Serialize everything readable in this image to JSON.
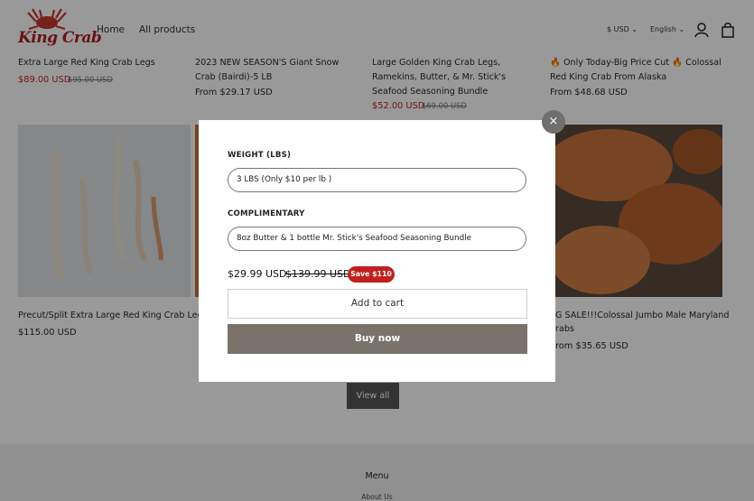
{
  "header": {
    "logo_text": "King Crab",
    "nav": [
      "Home",
      "All products"
    ],
    "currency": "$ USD",
    "language": "English"
  },
  "products_row1": [
    {
      "title": "Extra Large Red King Crab Legs",
      "price": "$89.00 USD",
      "compare": "$95.00 USD"
    },
    {
      "title": "2023 NEW SEASON'S Giant Snow Crab (Bairdi)-5 LB",
      "price": "From $29.17 USD"
    },
    {
      "title": "Large Golden King Crab Legs, Ramekins, Butter, & Mr. Stick's Seafood Seasoning Bundle",
      "price": "$52.00 USD",
      "compare": "$69.00 USD"
    },
    {
      "title": "🔥 Only Today-Big Price Cut 🔥 Colossal Red King Crab From Alaska",
      "price": "From $48.68 USD"
    }
  ],
  "products_row2": [
    {
      "title": "Precut/Split Extra Large Red King Crab Legs",
      "price": "$115.00 USD"
    },
    {
      "title": "G SALE!!!Colossal Jumbo Male Maryland",
      "title2": "rabs",
      "price": "rom $35.65 USD"
    }
  ],
  "view_all": "View all",
  "footer": {
    "menu_title": "Menu",
    "link": "About Us"
  },
  "modal": {
    "close": "×",
    "weight_label": "WEIGHT (LBS)",
    "weight_value": "3 LBS (Only $10 per lb )",
    "complimentary_label": "COMPLIMENTARY",
    "complimentary_value": "8oz Butter & 1 bottle Mr. Stick's Seafood Seasoning Bundle",
    "price": "$29.99 USD",
    "compare_price": "$139.99 USD",
    "save": "Save $110",
    "add_to_cart": "Add to cart",
    "buy_now": "Buy now"
  },
  "colors": {
    "accent_red": "#c21f1f",
    "buy_button": "#7a736b"
  }
}
